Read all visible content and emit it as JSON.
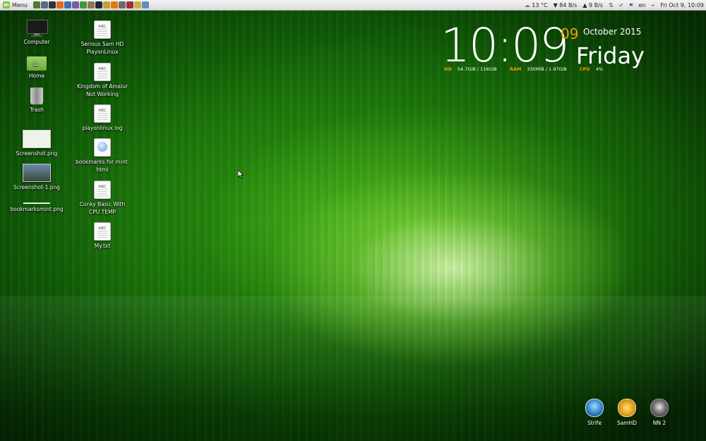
{
  "panel": {
    "menu_label": "Menu",
    "launchers": [
      {
        "icon": "show-desktop-icon",
        "color": "#4a7a2a"
      },
      {
        "icon": "files-icon",
        "color": "#5b6b7a"
      },
      {
        "icon": "terminal-icon",
        "color": "#333333"
      },
      {
        "icon": "firefox-icon",
        "color": "#e06a1e"
      },
      {
        "icon": "thunderbird-icon",
        "color": "#3a6fb0"
      },
      {
        "icon": "pidgin-icon",
        "color": "#7a5aa8"
      },
      {
        "icon": "chrome-icon",
        "color": "#3a9a3a"
      },
      {
        "icon": "gimp-icon",
        "color": "#8a7a50"
      },
      {
        "icon": "steam-icon",
        "color": "#1b2838"
      },
      {
        "icon": "playonlinux-icon",
        "color": "#c8a030"
      },
      {
        "icon": "vlc-icon",
        "color": "#e07a10"
      },
      {
        "icon": "editor-icon",
        "color": "#6a6a6a"
      },
      {
        "icon": "game-icon",
        "color": "#a03030"
      },
      {
        "icon": "document-icon",
        "color": "#d0b040"
      },
      {
        "icon": "settings-icon",
        "color": "#6090c0"
      }
    ],
    "weather": "13 °C",
    "download": "84 B/s",
    "upload": "9 B/s",
    "keyboard": "en",
    "clock": "Fri Oct  9, 10:09"
  },
  "desktop": {
    "col1": [
      {
        "label": "Computer",
        "icon": "computer-icon"
      },
      {
        "label": "Home",
        "icon": "home-folder-icon"
      },
      {
        "label": "Trash",
        "icon": "trash-icon"
      },
      {
        "label": "Screenshot.png",
        "icon": "image-thumbnail-icon"
      },
      {
        "label": "Screenshot-1.png",
        "icon": "image-thumbnail-icon"
      },
      {
        "label": "bookmarksmint.png",
        "icon": "image-thumbnail-icon"
      }
    ],
    "col2": [
      {
        "label": "Serious Sam HD PlayonLinux",
        "icon": "text-file-icon"
      },
      {
        "label": "Kingdom of Amalur Not Working",
        "icon": "text-file-icon"
      },
      {
        "label": "playonlinux.log",
        "icon": "text-file-icon"
      },
      {
        "label": "bookmarks for mint. html",
        "icon": "html-file-icon"
      },
      {
        "label": "Conky Basic With CPU TEMP",
        "icon": "text-file-icon"
      },
      {
        "label": "My.txt",
        "icon": "text-file-icon"
      }
    ],
    "doc_icon_text": "ABC"
  },
  "conky": {
    "time": "10:09",
    "day": "09",
    "month_year": "October 2015",
    "weekday": "Friday",
    "hd_label": "HD",
    "hd_value": "54.7GiB / 116GiB",
    "ram_label": "RAM",
    "ram_value": "330MiB / 1.97GiB",
    "cpu_label": "CPU",
    "cpu_value": "4%"
  },
  "games": [
    {
      "label": "Strife",
      "icon": "strife-icon",
      "color": "#2a7ac0"
    },
    {
      "label": "SamHD",
      "icon": "serious-sam-icon",
      "color": "#e0a020"
    },
    {
      "label": "NN 2",
      "icon": "nn2-skull-icon",
      "color": "#3a3a3a"
    }
  ]
}
